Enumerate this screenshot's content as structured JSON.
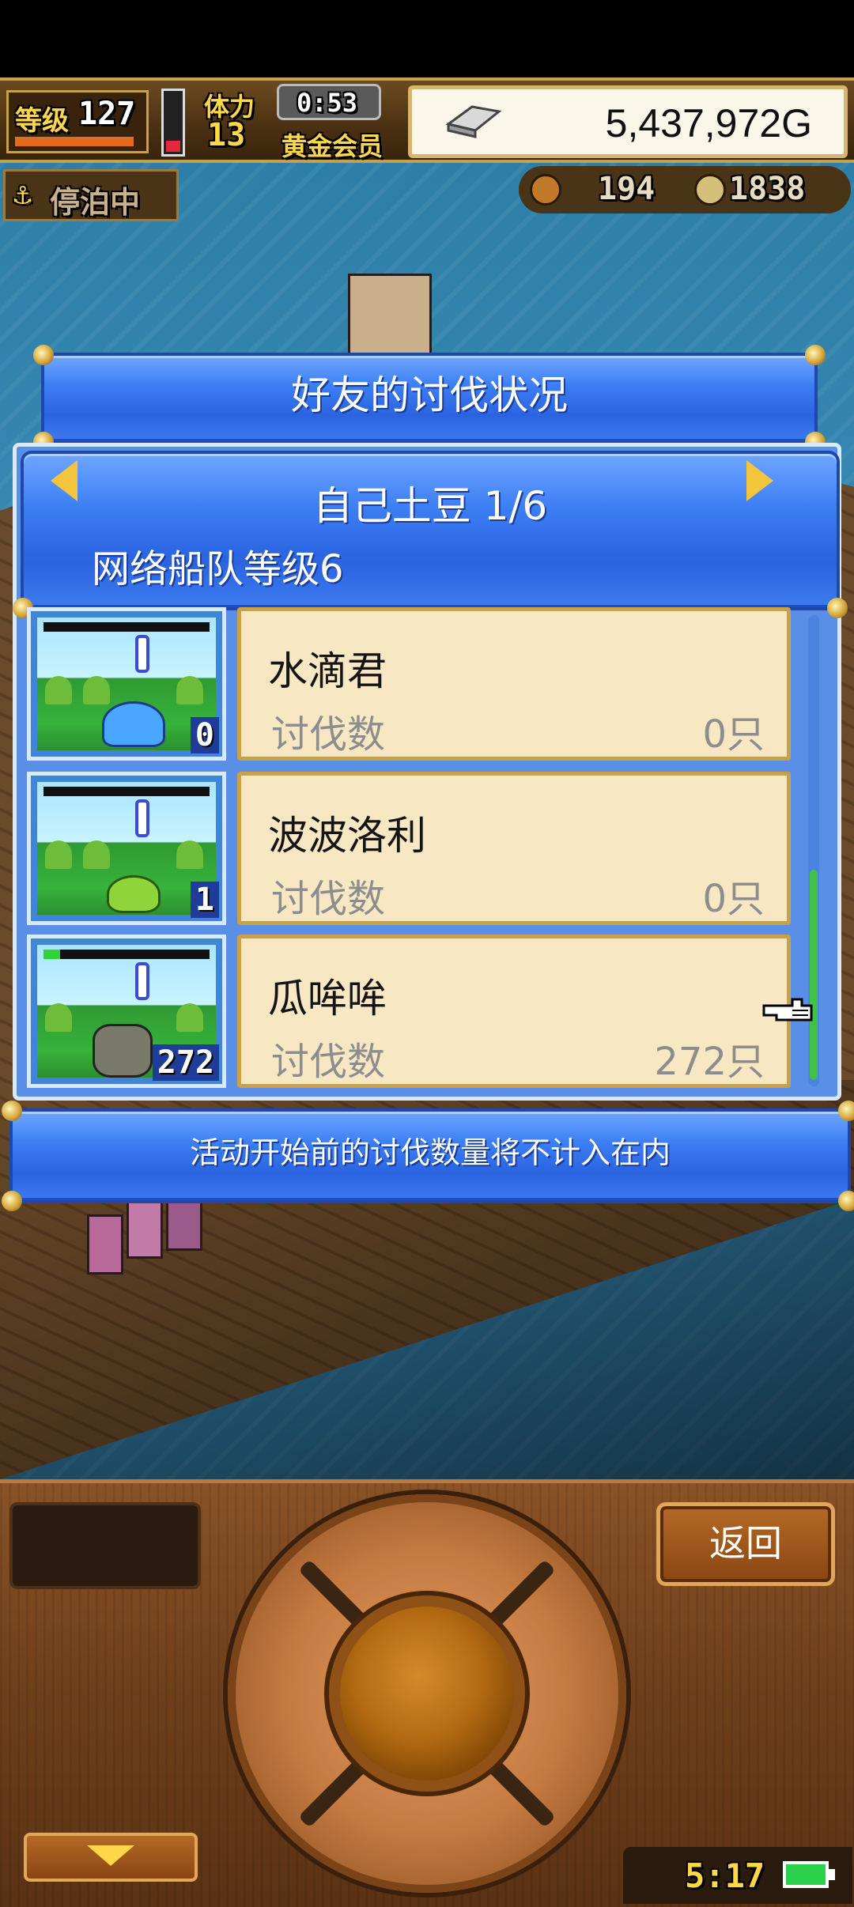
{
  "hud": {
    "level_label": "等级",
    "level_value": "127",
    "stamina_label": "体力",
    "stamina_value": "13",
    "timer": "0:53",
    "membership": "黄金会员",
    "gold": "5,437,972G",
    "docked_status": "停泊中",
    "resource_1": "194",
    "resource_2": "1838"
  },
  "modal": {
    "title": "好友的讨伐状况",
    "friend_name": "自己土豆 1/6",
    "fleet_level": "网络船队等级6",
    "notice": "活动开始前的讨伐数量将不计入在内",
    "monsters": [
      {
        "name": "水滴君",
        "kill_label": "讨伐数",
        "kill_count": "0只",
        "badge": "0",
        "hp_fraction": 0.0,
        "color": "#4aa6ff"
      },
      {
        "name": "波波洛利",
        "kill_label": "讨伐数",
        "kill_count": "0只",
        "badge": "1",
        "hp_fraction": 0.0,
        "color": "#8fd43a"
      },
      {
        "name": "瓜哞哞",
        "kill_label": "讨伐数",
        "kill_count": "272只",
        "badge": "272",
        "hp_fraction": 0.1,
        "color": "#7a7a6a"
      }
    ]
  },
  "controls": {
    "back_label": "返回",
    "clock": "5:17"
  },
  "colors": {
    "modal_blue": "#3c7ef4",
    "card_cream": "#f7e8c3",
    "gold_accent": "#ffd84a",
    "wood": "#6e3f1b"
  },
  "icons": {
    "prev": "triangle-left-icon",
    "next": "triangle-right-icon",
    "anchor": "anchor-icon",
    "gold_bar": "gold-bar-icon",
    "cursor": "pointing-hand-icon",
    "battery": "battery-icon"
  }
}
